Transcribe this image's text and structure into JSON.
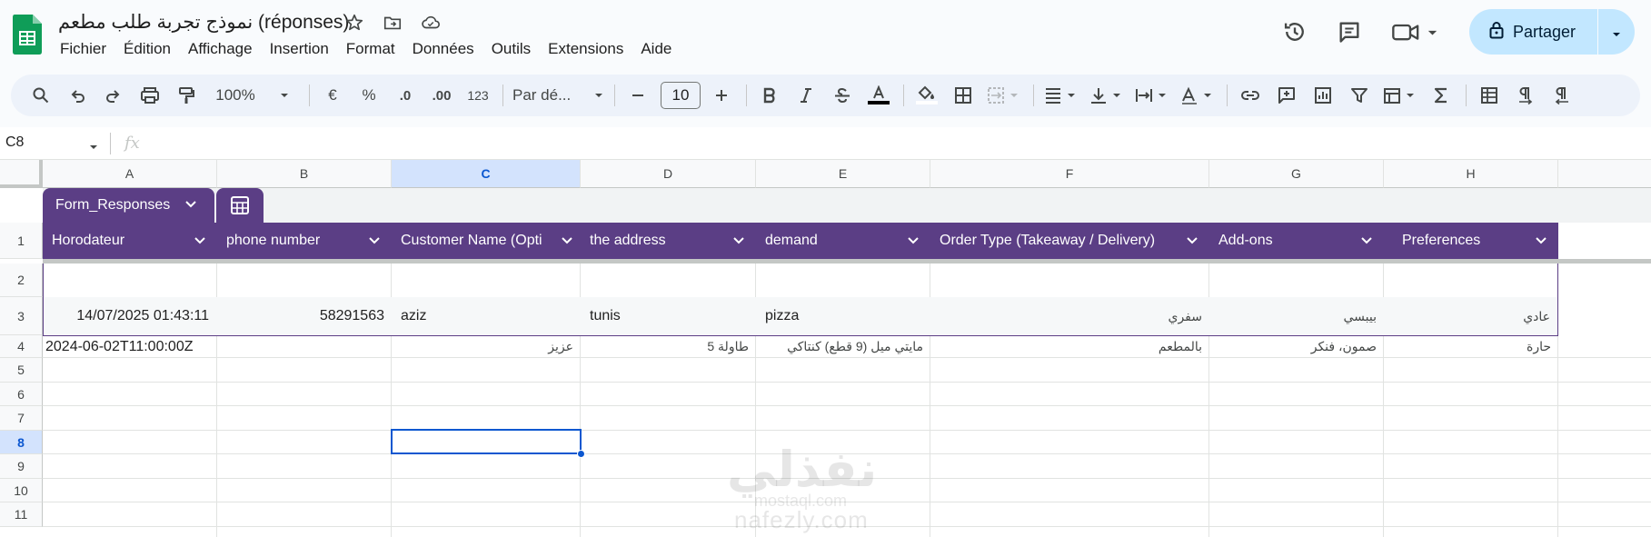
{
  "app": {
    "title": "نموذج تجربة طلب مطعم (réponses)",
    "menu": [
      "Fichier",
      "Édition",
      "Affichage",
      "Insertion",
      "Format",
      "Données",
      "Outils",
      "Extensions",
      "Aide"
    ],
    "share_label": "Partager",
    "accent_color": "#c2e7ff"
  },
  "toolbar": {
    "zoom": "100%",
    "currency": "€",
    "percent": "%",
    "decimal_decrease": ".0",
    "decimal_increase": ".00",
    "number_format": "123",
    "font": "Par dé...",
    "font_size": "10"
  },
  "formula_bar": {
    "name_box": "C8",
    "fx": "fx"
  },
  "grid": {
    "columns": [
      "A",
      "B",
      "C",
      "D",
      "E",
      "F",
      "G",
      "H"
    ],
    "selected_column": "C",
    "rows": [
      "1",
      "2",
      "3",
      "4",
      "5",
      "6",
      "7",
      "8",
      "9",
      "10",
      "11"
    ],
    "selected_row": "8",
    "table_name": "Form_Responses",
    "table_color": "#5b3e85",
    "headers": [
      "Horodateur",
      "phone number",
      "Customer Name (Opti",
      "the address",
      "demand",
      "Order Type (Takeaway / Delivery)",
      "Add-ons",
      "Preferences"
    ],
    "row3": [
      "14/07/2025 01:43:11",
      "58291563",
      "aziz",
      "tunis",
      "pizza",
      "سفري",
      "بيبسي",
      "عادي"
    ],
    "row4": [
      "2024-06-02T11:00:00Z",
      "",
      "عزيز",
      "طاولة 5",
      "مايتي ميل (9 قطع) كنتاكي",
      "بالمطعم",
      "صمون، فنكر",
      "حارة"
    ]
  },
  "watermark": {
    "brand": "نفذلي",
    "latin": "nafezly.com",
    "sub": "mostaql.com"
  }
}
